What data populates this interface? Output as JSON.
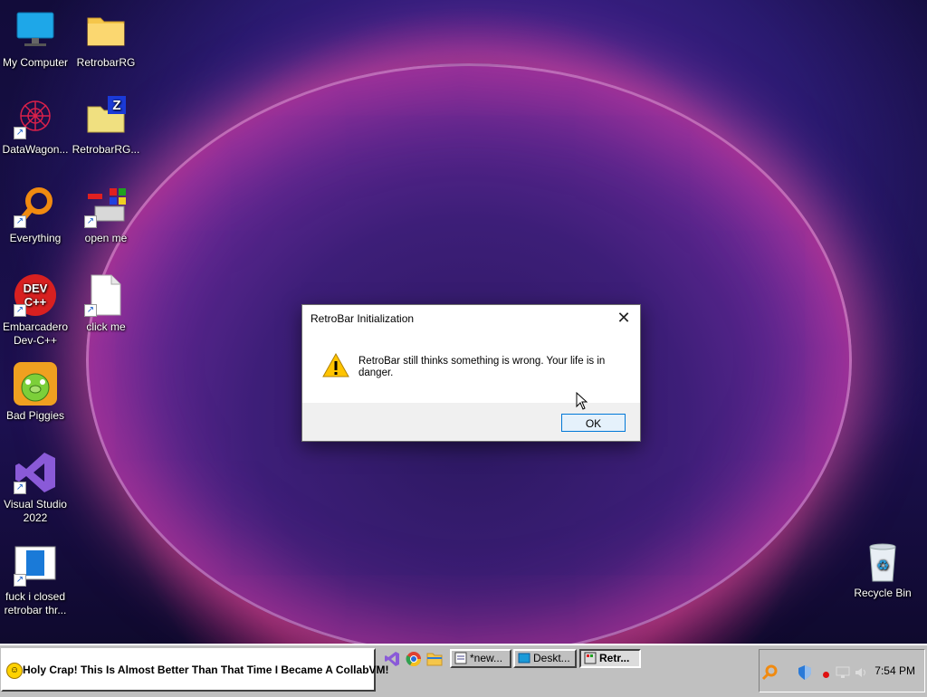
{
  "desktop": {
    "icons": [
      {
        "label": "My Computer"
      },
      {
        "label": "RetrobarRG"
      },
      {
        "label": "DataWagon..."
      },
      {
        "label": "RetrobarRG..."
      },
      {
        "label": "Everything"
      },
      {
        "label": "open me"
      },
      {
        "label": "Embarcadero Dev-C++"
      },
      {
        "label": "click me"
      },
      {
        "label": "Bad Piggies"
      },
      {
        "label": "Visual Studio 2022"
      },
      {
        "label": "fuck i closed retrobar thr..."
      },
      {
        "label": "Recycle Bin"
      }
    ]
  },
  "dialog": {
    "title": "RetroBar Initialization",
    "close_glyph": "✕",
    "message": "RetroBar still thinks something is wrong. Your life is in danger.",
    "ok_label": "OK",
    "icon": "warning-icon"
  },
  "taskbar": {
    "start_label": "Holy Crap! This Is Almost Better Than That Time I Became A CollabVM!",
    "quicklaunch": [
      "visual-studio-icon",
      "chrome-icon",
      "file-explorer-icon"
    ],
    "tasks": [
      {
        "label": "*new..."
      },
      {
        "label": "Deskt..."
      },
      {
        "label": "Retr..."
      }
    ],
    "tray": {
      "time": "7:54 PM"
    }
  }
}
